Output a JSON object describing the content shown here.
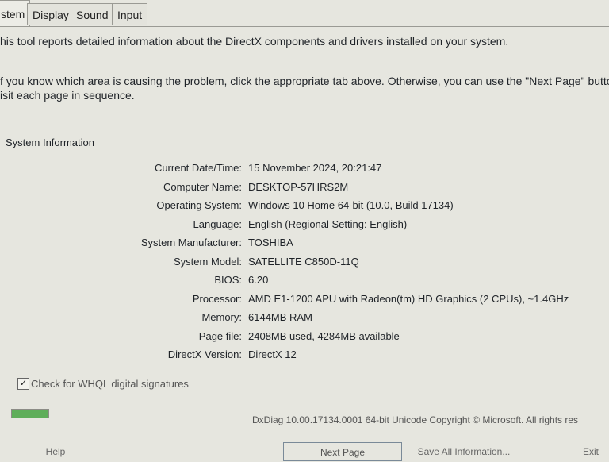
{
  "tabs": [
    "stem",
    "Display",
    "Sound",
    "Input"
  ],
  "intro": {
    "line1": "his tool reports detailed information about the DirectX components and drivers installed on your system.",
    "line2": "f you know which area is causing the problem, click the appropriate tab above.  Otherwise, you can use the \"Next Page\" button",
    "line3": "isit each page in sequence."
  },
  "system_info": {
    "title": "System Information",
    "rows": [
      {
        "label": "Current Date/Time:",
        "value": "15 November 2024, 20:21:47"
      },
      {
        "label": "Computer Name:",
        "value": "DESKTOP-57HRS2M"
      },
      {
        "label": "Operating System:",
        "value": "Windows 10 Home 64-bit (10.0, Build 17134)"
      },
      {
        "label": "Language:",
        "value": "English (Regional Setting: English)"
      },
      {
        "label": "System Manufacturer:",
        "value": "TOSHIBA"
      },
      {
        "label": "System Model:",
        "value": "SATELLITE C850D-11Q"
      },
      {
        "label": "BIOS:",
        "value": "6.20"
      },
      {
        "label": "Processor:",
        "value": "AMD E1-1200 APU with Radeon(tm) HD Graphics (2 CPUs), ~1.4GHz"
      },
      {
        "label": "Memory:",
        "value": "6144MB RAM"
      },
      {
        "label": "Page file:",
        "value": "2408MB used, 4284MB available"
      },
      {
        "label": "DirectX Version:",
        "value": "DirectX 12"
      }
    ]
  },
  "whql": {
    "label": "Check for WHQL digital signatures",
    "checked": true
  },
  "progress": {
    "fraction": 1.0
  },
  "footer_info": "DxDiag 10.00.17134.0001 64-bit Unicode  Copyright © Microsoft. All rights res",
  "buttons": {
    "help": "Help",
    "next": "Next Page",
    "save": "Save All Information...",
    "exit": "Exit"
  }
}
